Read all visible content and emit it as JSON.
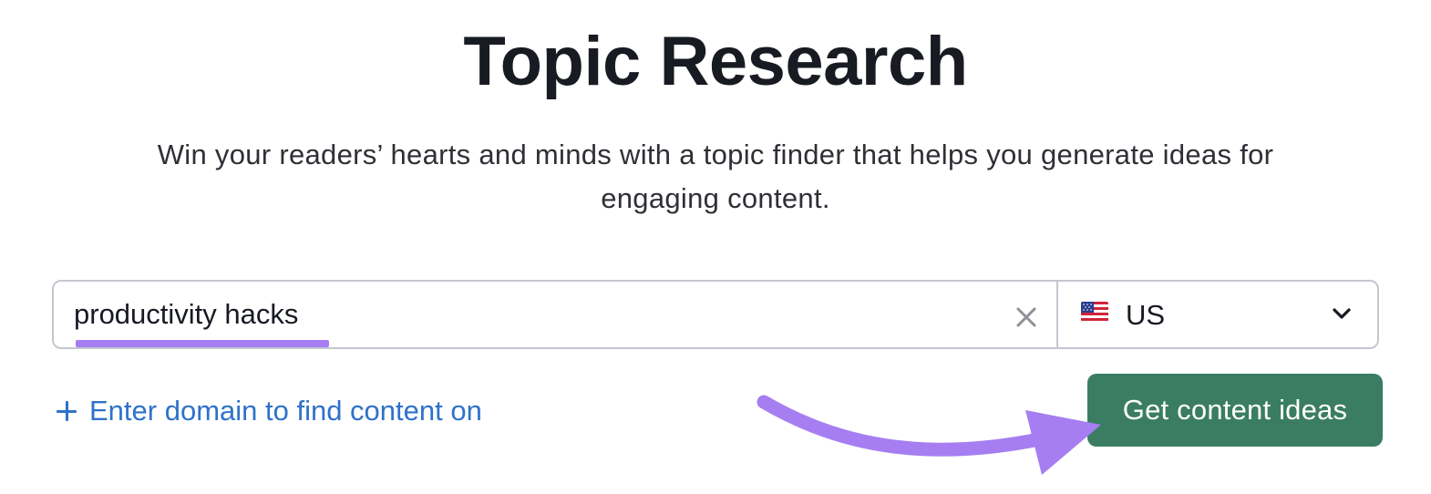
{
  "header": {
    "title": "Topic Research",
    "subtitle": "Win your readers’ hearts and minds with a topic finder that helps you generate ideas for engaging content."
  },
  "search": {
    "keyword_value": "productivity hacks",
    "clear_icon": "close-icon",
    "country": {
      "flag_icon": "us-flag-icon",
      "label": "US",
      "dropdown_icon": "chevron-down-icon"
    }
  },
  "actions": {
    "add_domain_icon": "plus-icon",
    "add_domain_label": "Enter domain to find content on",
    "submit_label": "Get content ideas"
  },
  "colors": {
    "title": "#191b23",
    "link": "#2e72c9",
    "button": "#3a7d63",
    "highlight": "#a67ef2",
    "border": "#c4c7cf"
  }
}
